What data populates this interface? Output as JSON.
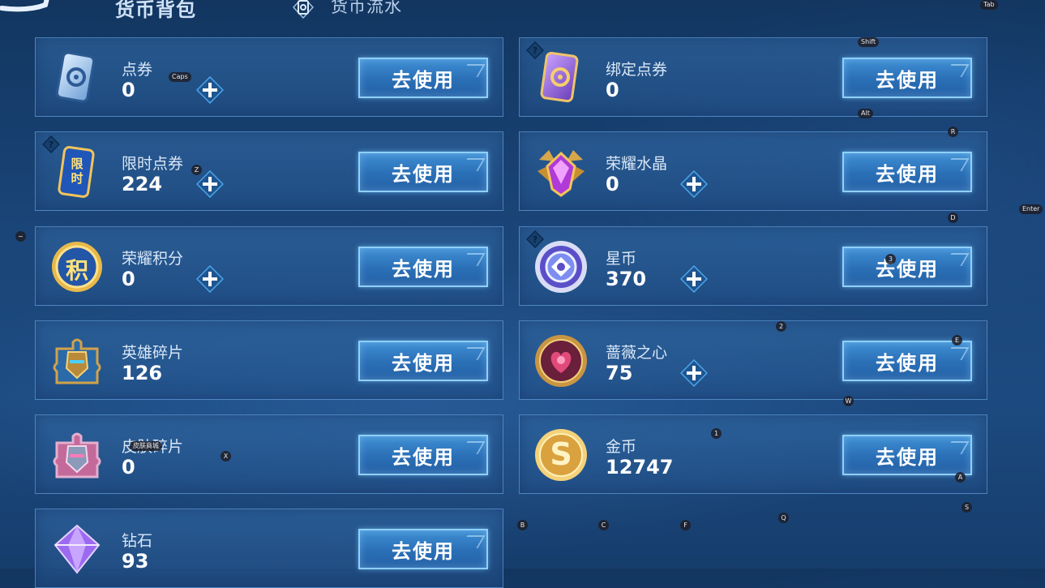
{
  "header": {
    "title": "货币背包",
    "flow_tab": "货币流水"
  },
  "common": {
    "use_label": "去使用"
  },
  "currencies": [
    {
      "name": "点券",
      "amount": "0",
      "has_plus": true,
      "has_help": false,
      "icon": "coupon-card-icon"
    },
    {
      "name": "绑定点券",
      "amount": "0",
      "has_plus": false,
      "has_help": true,
      "icon": "bound-coupon-card-icon"
    },
    {
      "name": "限时点券",
      "amount": "224",
      "has_plus": true,
      "has_help": true,
      "icon": "limited-coupon-icon",
      "icon_text": "限时"
    },
    {
      "name": "荣耀水晶",
      "amount": "0",
      "has_plus": true,
      "has_help": false,
      "icon": "glory-crystal-icon"
    },
    {
      "name": "荣耀积分",
      "amount": "0",
      "has_plus": true,
      "has_help": false,
      "icon": "glory-points-icon",
      "icon_text": "积"
    },
    {
      "name": "星币",
      "amount": "370",
      "has_plus": true,
      "has_help": true,
      "icon": "star-coin-icon"
    },
    {
      "name": "英雄碎片",
      "amount": "126",
      "has_plus": false,
      "has_help": false,
      "icon": "hero-fragment-icon"
    },
    {
      "name": "蔷薇之心",
      "amount": "75",
      "has_plus": true,
      "has_help": false,
      "icon": "rose-heart-icon"
    },
    {
      "name": "皮肤碎片",
      "amount": "0",
      "has_plus": false,
      "has_help": false,
      "icon": "skin-fragment-icon"
    },
    {
      "name": "金币",
      "amount": "12747",
      "has_plus": false,
      "has_help": false,
      "icon": "gold-coin-icon",
      "icon_text": "S"
    },
    {
      "name": "钻石",
      "amount": "93",
      "has_plus": false,
      "has_help": false,
      "icon": "diamond-icon"
    }
  ],
  "key_hints": {
    "tab": "Tab",
    "shift": "Shift",
    "caps": "Caps",
    "alt": "Alt",
    "r": "R",
    "z": "Z",
    "d": "D",
    "enter": "Enter",
    "tilde": "~",
    "three": "3",
    "two": "2",
    "e": "E",
    "w": "W",
    "one": "1",
    "x": "X",
    "a": "A",
    "s": "S",
    "b": "B",
    "c": "C",
    "f": "F",
    "q": "Q",
    "skin_overlay": "皮肤商城"
  },
  "colors": {
    "background": "#1a4578",
    "button": "#2a6fb6",
    "button_border": "#8fd0ff",
    "plus": "#4aa6ea"
  }
}
